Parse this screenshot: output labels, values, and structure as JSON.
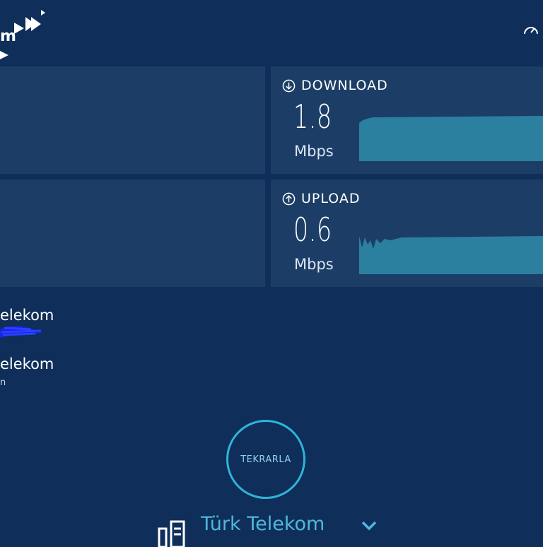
{
  "brand": {
    "logo_text": "m",
    "logo_icon": "arrows-logo-icon"
  },
  "header": {
    "speed_icon": "speedometer-icon"
  },
  "metrics": {
    "download": {
      "title": "DOWNLOAD",
      "value": "1.8",
      "unit": "Mbps",
      "icon": "download-arrow-icon"
    },
    "upload": {
      "title": "UPLOAD",
      "value": "0.6",
      "unit": "Mbps",
      "icon": "upload-arrow-icon"
    }
  },
  "providers": [
    {
      "name": "elekom",
      "detail": ""
    },
    {
      "name": "elekom",
      "detail": "n"
    }
  ],
  "actions": {
    "repeat_label": "TEKRARLA"
  },
  "server": {
    "name": "Türk Telekom",
    "icon": "server-icon",
    "dropdown_icon": "chevron-down-icon"
  },
  "colors": {
    "background": "#0f2e5a",
    "panel": "#1c3d66",
    "accent": "#2fb4d6",
    "graph": "#2b7f9f"
  }
}
